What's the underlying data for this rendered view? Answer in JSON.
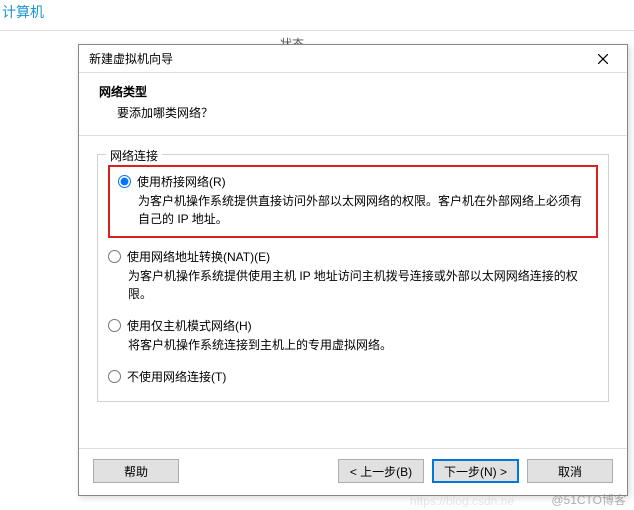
{
  "background": {
    "link_text": "计算机",
    "status_header": "状态"
  },
  "dialog": {
    "title": "新建虚拟机向导",
    "header": {
      "title": "网络类型",
      "subtitle": "要添加哪类网络？"
    },
    "fieldset_legend": "网络连接",
    "options": {
      "bridged": {
        "label": "使用桥接网络(R)",
        "desc": "为客户机操作系统提供直接访问外部以太网网络的权限。客户机在外部网络上必须有自己的 IP 地址。"
      },
      "nat": {
        "label": "使用网络地址转换(NAT)(E)",
        "desc": "为客户机操作系统提供使用主机 IP 地址访问主机拨号连接或外部以太网网络连接的权限。"
      },
      "hostonly": {
        "label": "使用仅主机模式网络(H)",
        "desc": "将客户机操作系统连接到主机上的专用虚拟网络。"
      },
      "none": {
        "label": "不使用网络连接(T)"
      }
    },
    "buttons": {
      "help": "帮助",
      "back": "< 上一步(B)",
      "next": "下一步(N) >",
      "cancel": "取消"
    }
  },
  "watermark": "@51CTO博客",
  "watermark2": "https://blog.csdn.ne"
}
